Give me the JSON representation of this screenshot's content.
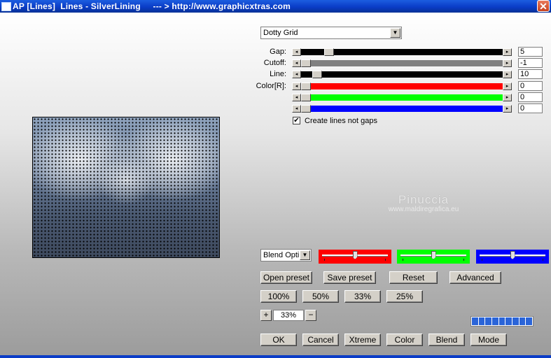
{
  "window": {
    "title": "AP [Lines]  Lines - SilverLining     --- > http://www.graphicxtras.com",
    "close_glyph": "✕"
  },
  "filter_dropdown": {
    "selected": "Dotty Grid"
  },
  "sliders": [
    {
      "label": "Gap:",
      "value": "5",
      "level": 0.12,
      "fill_color": "#000000"
    },
    {
      "label": "Cutoff:",
      "value": "-1",
      "level": 0.0,
      "fill_color": "#808080"
    },
    {
      "label": "Line:",
      "value": "10",
      "level": 0.06,
      "fill_color": "#000000"
    },
    {
      "label": "Color[R]:",
      "value": "0",
      "level": 0.0,
      "fill_color": "#ff0000"
    },
    {
      "label": "",
      "value": "0",
      "level": 0.0,
      "fill_color": "#00ff00"
    },
    {
      "label": "",
      "value": "0",
      "level": 0.0,
      "fill_color": "#0000ff"
    }
  ],
  "checkbox": {
    "label": "Create lines not gaps",
    "checked": true,
    "glyph": "✔"
  },
  "watermark": {
    "line1": "Pinuccia",
    "line2": "www.maldiregrafica.eu"
  },
  "blend_dropdown": {
    "selected": "Blend Optio"
  },
  "color_boxes": [
    {
      "color": "#ff0000",
      "level": 0.5
    },
    {
      "color": "#00ff00",
      "level": 0.5
    },
    {
      "color": "#0000ff",
      "level": 0.5
    }
  ],
  "preset_buttons": {
    "open": "Open preset",
    "save": "Save preset",
    "reset": "Reset",
    "advanced": "Advanced"
  },
  "zoom_buttons": [
    "100%",
    "50%",
    "33%",
    "25%"
  ],
  "zoom": {
    "plus": "+",
    "value": "33%",
    "minus": "−"
  },
  "progress_segments": 9,
  "action_buttons": {
    "ok": "OK",
    "cancel": "Cancel",
    "xtreme": "Xtreme",
    "color": "Color",
    "blend": "Blend",
    "mode": "Mode"
  }
}
